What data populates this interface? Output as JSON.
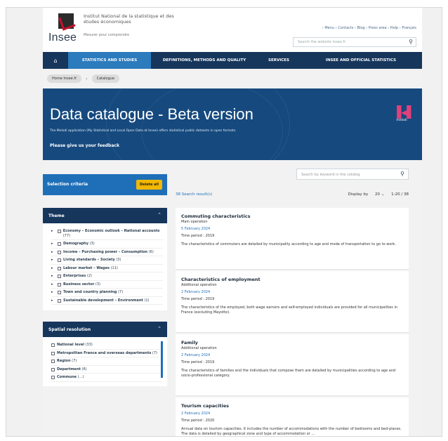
{
  "header": {
    "logo_word": "Insee",
    "institute_name": "Institut National de la statistique et des études économiques",
    "institute_link": "Mesurer pour comprendre",
    "top_links": "› Menu  › Contacts  › Blog  › Press area  › Help  › Français",
    "search_placeholder": "Search the website insee.fr"
  },
  "nav": {
    "home_icon": "home-icon",
    "items": [
      {
        "label": "STATISTICS AND STUDIES"
      },
      {
        "label": "DEFINITIONS, METHODS AND QUALITY"
      },
      {
        "label": "SERVICES"
      },
      {
        "label": "INSEE AND OFFICIAL STATISTICS"
      }
    ]
  },
  "breadcrumb": [
    "Home Insee.fr",
    "Catalogue"
  ],
  "hero": {
    "title": "Data catalogue - Beta version",
    "description": "The Melodi application (My Statistical and Local Open Data at Insee) offers statistical public datasets in open formats.",
    "feedback": "Please give us your feedback",
    "brand": "melodi",
    "brand_color": "#e2407a"
  },
  "selection": {
    "title": "Selection criteria",
    "delete_all": "Delete all"
  },
  "theme_panel": {
    "title": "Theme",
    "items": [
      {
        "label": "Economy – Economic outlook – National accounts",
        "count": "(77)"
      },
      {
        "label": "Demography",
        "count": "(3)"
      },
      {
        "label": "Income – Purchasing power – Consumption",
        "count": "(6)"
      },
      {
        "label": "Living standards – Society",
        "count": "(3)"
      },
      {
        "label": "Labour market – Wages",
        "count": "(11)"
      },
      {
        "label": "Enterprises",
        "count": "(2)"
      },
      {
        "label": "Business sector",
        "count": "(3)"
      },
      {
        "label": "Town and country planning",
        "count": "(7)"
      },
      {
        "label": "Sustainable development – Environment",
        "count": "(1)"
      }
    ]
  },
  "spatial_panel": {
    "title": "Spatial resolution",
    "items": [
      {
        "label": "National level",
        "count": "(33)"
      },
      {
        "label": "Metropolitan France and overseas departments",
        "count": "(7)"
      },
      {
        "label": "Region",
        "count": "(7)"
      },
      {
        "label": "Department",
        "count": "(6)"
      },
      {
        "label": "Commune",
        "count": "(…)"
      }
    ]
  },
  "results": {
    "search_placeholder": "Search by keyword in the catalog",
    "count_text": "38 Search result(s)",
    "display_by_label": "Display by",
    "display_by_value": "20 ⌄",
    "range": "1-20 / 38"
  },
  "cards": [
    {
      "title": "Commuting characteristics",
      "type": "Main operation",
      "date": "5 February 2024",
      "period": "Time period : 2019",
      "desc": "The characteristics of commuters are detailed by municipality according to age and mode of transportation to go to work."
    },
    {
      "title": "Characteristics of employment",
      "type": "Additional operation",
      "date": "2 February 2024",
      "period": "Time period : 2019",
      "desc": "The characteristics of the employed, both wage earners and self-employed individuals are provided for all municipalities in France (excluding Mayotte)."
    },
    {
      "title": "Family",
      "type": "Additional operation",
      "date": "2 February 2024",
      "period": "Time period : 2019",
      "desc": "The characteristics of families and the individuals that compose them are detailed by municipalities according to age and socio-professional category."
    },
    {
      "title": "Tourism capacities",
      "type": "",
      "date": "2 February 2024",
      "period": "Time period : 2020",
      "desc": "Annual data on tourism capacities. It includes the number of accommodations with the number of bedrooms and bed-places. The data is detailed by geographical zone and type of accommodation or …"
    }
  ]
}
